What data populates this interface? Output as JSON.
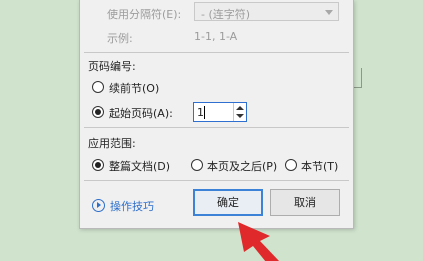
{
  "separator_section": {
    "label": "使用分隔符(E):",
    "select_value": "-    (连字符)",
    "example_label": "示例:",
    "example_value": "1-1, 1-A"
  },
  "page_numbering": {
    "title": "页码编号:",
    "continue_label": "续前节(O)",
    "start_label": "起始页码(A):",
    "start_value": "1"
  },
  "apply_range": {
    "title": "应用范围:",
    "options": [
      "整篇文档(D)",
      "本页及之后(P)",
      "本节(T)"
    ],
    "selected": "整篇文档(D)"
  },
  "footer": {
    "tips_label": "操作技巧",
    "ok_label": "确定",
    "cancel_label": "取消"
  },
  "colors": {
    "accent": "#2c6ecb",
    "background": "#cfe3cd",
    "cursor": "#e0292b"
  }
}
